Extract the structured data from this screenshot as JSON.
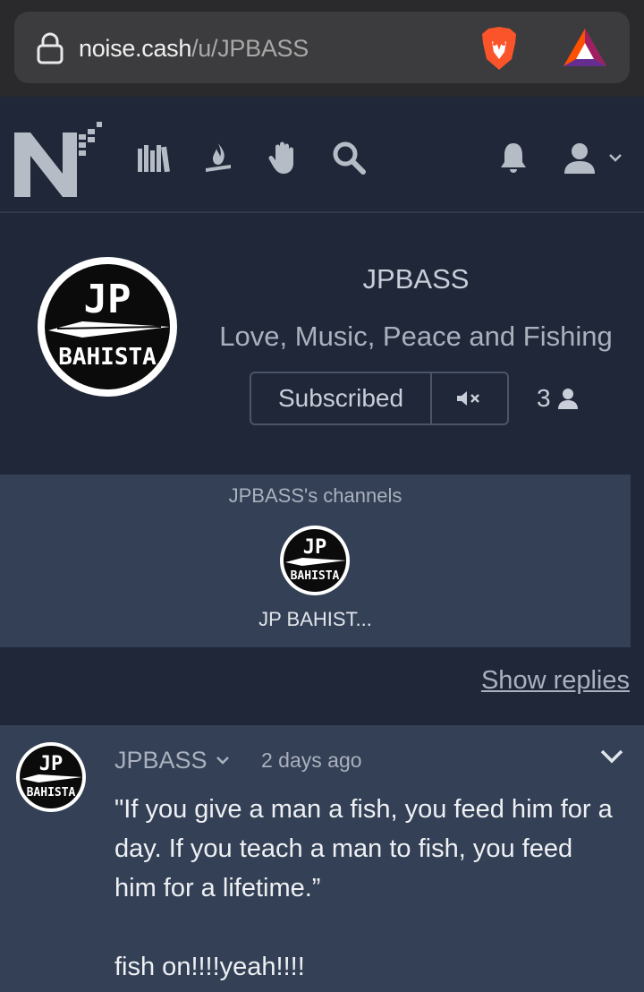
{
  "browser": {
    "url_host": "noise.cash",
    "url_path": "/u/JPBASS"
  },
  "profile": {
    "username": "JPBASS",
    "bio": "Love, Music, Peace and Fishing",
    "subscribed_label": "Subscribed",
    "subscriber_count": "3",
    "avatar_text_top": "JP",
    "avatar_text_bottom": "BAHISTA"
  },
  "channels": {
    "title": "JPBASS's channels",
    "items": [
      {
        "name": "JP BAHIST..."
      }
    ]
  },
  "feed": {
    "show_replies_label": "Show replies"
  },
  "post": {
    "author": "JPBASS",
    "time": "2 days ago",
    "body": "\"If you give a man a fish, you feed him for a day. If you teach a man to fish, you feed him for a lifetime.”\n\nfish on!!!!yeah!!!!"
  },
  "colors": {
    "background": "#1f2738",
    "panel": "#334055",
    "brave_orange": "#fb542b",
    "bat_purple": "#662d91"
  },
  "icons": [
    "lock-icon",
    "brave-icon",
    "bat-icon",
    "noise-logo",
    "books-icon",
    "fire-icon",
    "hand-icon",
    "search-icon",
    "bell-icon",
    "user-icon",
    "chevron-down-icon",
    "mute-icon"
  ]
}
